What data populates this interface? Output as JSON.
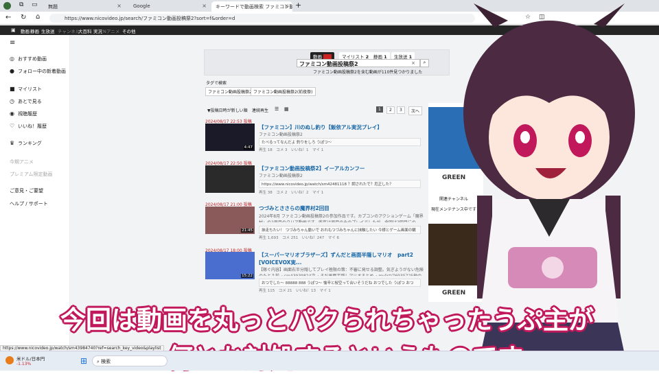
{
  "browser": {
    "tabs": [
      {
        "label": "無題"
      },
      {
        "label": "Google"
      },
      {
        "label": "キーワードで動画検索 ファミコン動画..."
      }
    ],
    "url": "https://www.nicovideo.jp/search/ファミコン動画投稿祭2?sort=f&order=d",
    "status_url": "https://www.nicovideo.jp/watch/sm43984740?ref=search_key_video&playlist"
  },
  "nicobar": {
    "items": [
      "動画",
      "静画",
      "生放送",
      "チャンネル",
      "大百科",
      "実況",
      "Nアニメ",
      "その他"
    ]
  },
  "sidebar": {
    "items": [
      {
        "label": "おすすめ動画"
      },
      {
        "label": "フォロー中の新着動画"
      },
      {
        "label": "マイリスト"
      },
      {
        "label": "あとで見る"
      },
      {
        "label": "視聴履歴"
      },
      {
        "label": "いいね！履歴"
      },
      {
        "label": "ランキング"
      },
      {
        "label": "今期アニメ"
      },
      {
        "label": "プレミアム限定動画"
      },
      {
        "label": "ご意見・ご要望"
      },
      {
        "label": "ヘルプ / サポート"
      }
    ]
  },
  "search": {
    "tabs": [
      {
        "label": "動画",
        "count": ""
      },
      {
        "label": "マイリスト",
        "count": "2"
      },
      {
        "label": "静画",
        "count": "1"
      },
      {
        "label": "生放送",
        "count": "1"
      }
    ],
    "query": "ファミコン動画投稿祭2",
    "result_text": "ファミコン動画投稿祭2を含む動画が110件見つかりました",
    "tag_heading": "タグで検索",
    "tags": [
      "ファミコン動画投稿祭2",
      "ファミコン動画投稿祭2(前夜祭)"
    ],
    "sort_label": "▼投稿日時が新しい順",
    "continuous_label": "連続再生",
    "pages": [
      "1",
      "2",
      "3"
    ],
    "next_label": "次へ"
  },
  "videos": [
    {
      "date": "2024/08/17 22:53",
      "badge": "投稿",
      "title": "【ファミコン】川のぬし釣り【飯依アル実況プレイ】",
      "sub": "ファミコン動画投稿祭2",
      "desc": "たべるってなんだよ 釣りをしろ うぽつ〜",
      "stats": "再生 18　コメ 3　いいね！1　マイ 1",
      "duration": "4:47"
    },
    {
      "date": "2024/08/17 22:50",
      "badge": "投稿",
      "title": "【ファミコン動画投稿祭2】イーアルカンフー",
      "sub": "ファミコン動画投稿祭2",
      "desc": "https://www.nicovideo.jp/watch/sm42481118 ？調されたで？厄正した？",
      "stats": "再生 38　コメ 2　いいね！2　マイ 1",
      "duration": ""
    },
    {
      "date": "2024/08/17 21:00",
      "badge": "投稿",
      "title": "つづみとささらの魔界村2回目",
      "sub": "2024年8月 ファミコン動画投稿祭2の参加作品です。カプコンのアクションゲーム「魔界村」の2周目のクリア動画です。昨年は周目のみのプレイでしたが、今回は2回目にの",
      "desc": "抹走ちたい！ つづみちゃん動いで おれもつづみちゃんに抹触したい 今様とゲーム画面の観",
      "stats": "再生 1,693　コメ 251　いいね！247　マイ 6",
      "duration": "21:45"
    },
    {
      "date": "2024/08/17 18:00",
      "badge": "投稿",
      "title": "【スーパーマリオブラザーズ】ずんだと画面半隠しマリオ　part2 [VOICEVOX実...",
      "sub": "【稼ぐ内容】画面右半分隠してプレイ極限の策：不審に発せる調整。気ぎようがない危険のたとえ前→ sm43939824次→ まだ画面半隠しマリオまとめ→ mylist/76935725他の動画...",
      "desc": "おつでした〜 88888 888 うぽつ〜 愉辛と桜空って合いそうだね おつでした うぽつ おつ",
      "stats": "再生 115　コメ 21　いいね！13　マイ 1",
      "duration": "15:22"
    }
  ],
  "ad": {
    "items": [
      "関連チャンネル",
      "現在メンテナンス中です"
    ],
    "brand": "GREEN"
  },
  "captions": {
    "line1": "今回は動画を丸っとパクられちゃったうぷ主が",
    "line2": "何とか対処するというものです"
  },
  "taskbar": {
    "weather": "米ドル/日本円",
    "weather_sub": "-1.13%",
    "search": "検索"
  },
  "colors": {
    "caption_outline": "#c0185a",
    "link": "#1565a6",
    "date": "#b22222"
  }
}
